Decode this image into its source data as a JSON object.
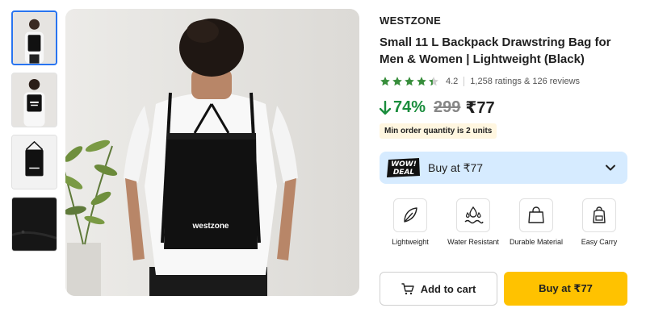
{
  "gallery": {
    "thumbnails": [
      {
        "name": "front-view"
      },
      {
        "name": "back-view"
      },
      {
        "name": "product-flat"
      },
      {
        "name": "fabric-closeup"
      }
    ],
    "bag_print": "westzone"
  },
  "product": {
    "brand": "WESTZONE",
    "title": "Small 11 L Backpack Drawstring Bag for Men & Women | Lightweight (Black)",
    "rating": "4.2",
    "rating_stars": 4.2,
    "ratings_reviews": "1,258 ratings & 126 reviews",
    "discount": "74%",
    "mrp": "299",
    "price": "₹77",
    "moq": "Min order quantity is 2 units"
  },
  "deal": {
    "badge_line1": "WOW!",
    "badge_line2": "DEAL",
    "label": "Buy at ₹77"
  },
  "features": [
    {
      "icon": "feather-icon",
      "label": "Lightweight"
    },
    {
      "icon": "water-resistant-icon",
      "label": "Water Resistant"
    },
    {
      "icon": "bag-icon",
      "label": "Durable Material"
    },
    {
      "icon": "backpack-icon",
      "label": "Easy Carry"
    }
  ],
  "actions": {
    "add_to_cart": "Add to cart",
    "buy_now": "Buy at ₹77"
  },
  "colors": {
    "accent_yellow": "#ffc200",
    "discount_green": "#1a8d3d",
    "star_green": "#388e3c",
    "deal_bg": "#d6ebff"
  }
}
